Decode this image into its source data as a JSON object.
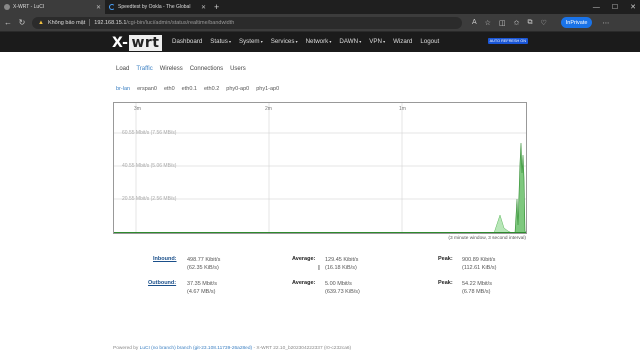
{
  "browser": {
    "tabs": [
      {
        "title": "X-WRT - LuCI",
        "active": true
      },
      {
        "title": "Speedtest by Ookla - The Global",
        "active": false
      }
    ],
    "security_label": "Không bảo mật",
    "url_host": "192.168.15.1",
    "url_path": "/cgi-bin/luci/admin/status/realtime/bandwidth",
    "inprivate_label": "InPrivate"
  },
  "header": {
    "brand_x": "X-",
    "brand_wrt": "wrt",
    "menu": [
      "Dashboard",
      "Status",
      "System",
      "Services",
      "Network",
      "DAWN",
      "VPN",
      "Wizard",
      "Logout"
    ],
    "badge": "AUTO REFRESH ON"
  },
  "realtime_tabs": [
    "Load",
    "Traffic",
    "Wireless",
    "Connections",
    "Users"
  ],
  "interface_tabs": [
    "br-lan",
    "erspan0",
    "eth0",
    "eth0.1",
    "eth0.2",
    "phy0-ap0",
    "phy1-ap0"
  ],
  "graph": {
    "time_labels": [
      "3m",
      "2m",
      "1m"
    ],
    "scale_labels": [
      "60.55 Mbit/s (7.56 MB/s)",
      "40.55 Mbit/s (5.06 MB/s)",
      "20.55 Mbit/s (2.56 MB/s)"
    ],
    "caption": "(3 minute window, 3 second interval)",
    "inbound_color": "#7ec87e",
    "outbound_color": "#3a7f3a"
  },
  "stats": {
    "inbound": {
      "label": "Inbound:",
      "current": "498.77 Kibit/s",
      "current_bytes": "(62.35 KiB/s)",
      "average_label": "Average:",
      "average": "129.45 Kibit/s",
      "average_bytes": "(16.18 KiB/s)",
      "peak_label": "Peak:",
      "peak": "900.89 Kibit/s",
      "peak_bytes": "(112.61 KiB/s)"
    },
    "outbound": {
      "label": "Outbound:",
      "current": "37.35 Mbit/s",
      "current_bytes": "(4.67 MB/s)",
      "average_label": "Average:",
      "average": "5.00 Mbit/s",
      "average_bytes": "(639.73 KiB/s)",
      "peak_label": "Peak:",
      "peak": "54.22 Mbit/s",
      "peak_bytes": "(6.78 MB/s)"
    }
  },
  "footer": {
    "prefix": "Powered by ",
    "luci": "LuCI (no branch) branch (git-23.108.11739-26a28ed)",
    "suffix": " - X-WRT 22.10_b202304222337 (r0-c232ca6)"
  }
}
